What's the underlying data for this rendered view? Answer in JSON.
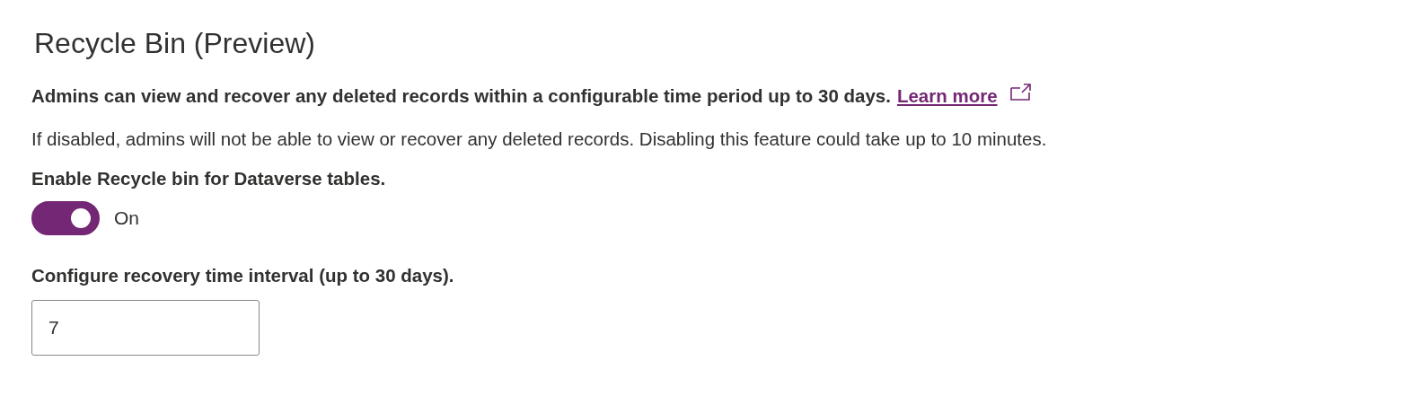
{
  "title": "Recycle Bin (Preview)",
  "description": {
    "text": "Admins can view and recover any deleted records within a configurable time period up to 30 days.",
    "link": "Learn more"
  },
  "note": "If disabled, admins will not be able to view or recover any deleted records. Disabling this feature could take up to 10 minutes.",
  "toggle": {
    "label": "Enable Recycle bin for Dataverse tables.",
    "on": true,
    "state_text": "On"
  },
  "interval": {
    "label": "Configure recovery time interval (up to 30 days).",
    "value": "7"
  }
}
